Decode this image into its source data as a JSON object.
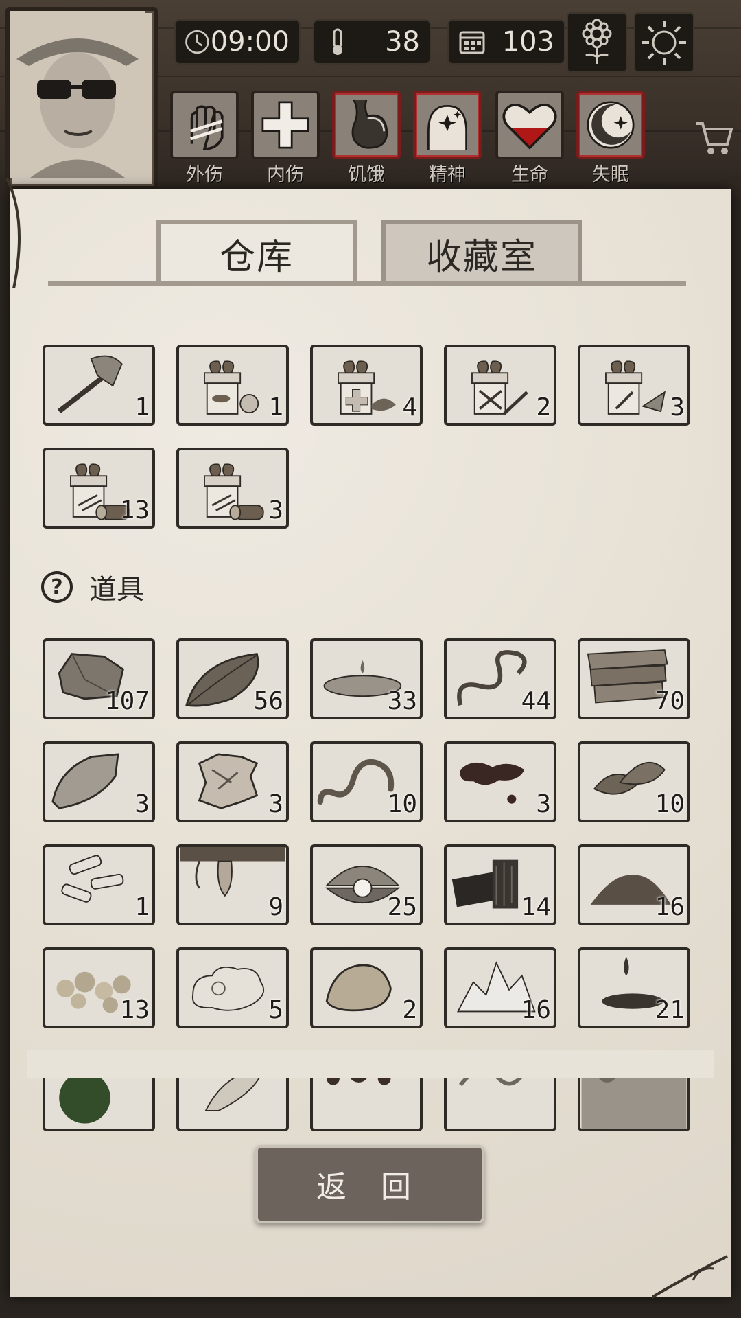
{
  "hud": {
    "time": "09:00",
    "temperature": "38",
    "day": "103",
    "icons": {
      "clock": "clock-icon",
      "thermometer": "thermometer-icon",
      "calendar": "calendar-icon",
      "flower": "flower-icon",
      "sun": "sun-icon",
      "cart": "cart-icon"
    }
  },
  "status_bar": [
    {
      "label": "外伤",
      "icon": "hand-bandage-icon",
      "warning": false
    },
    {
      "label": "内伤",
      "icon": "cross-icon",
      "warning": false
    },
    {
      "label": "饥饿",
      "icon": "stomach-icon",
      "warning": true
    },
    {
      "label": "精神",
      "icon": "head-sparkle-icon",
      "warning": true
    },
    {
      "label": "生命",
      "icon": "heart-icon",
      "warning": false,
      "fill": 0.45
    },
    {
      "label": "失眠",
      "icon": "moon-star-icon",
      "warning": true
    }
  ],
  "tabs": {
    "storage": "仓库",
    "collection": "收藏室",
    "active": "storage"
  },
  "equipment": [
    {
      "item": "axe",
      "count": "1"
    },
    {
      "item": "gift-box-food",
      "count": "1"
    },
    {
      "item": "gift-box-medical",
      "count": "4"
    },
    {
      "item": "gift-box-weapons",
      "count": "2"
    },
    {
      "item": "gift-box-tools",
      "count": "3"
    },
    {
      "item": "gift-box-wood",
      "count": "13"
    },
    {
      "item": "gift-box-wood",
      "count": "3"
    }
  ],
  "props_section": {
    "title": "道具",
    "icon": "question-icon"
  },
  "props": [
    {
      "item": "stone",
      "count": "107"
    },
    {
      "item": "leaf",
      "count": "56"
    },
    {
      "item": "water-puddle",
      "count": "33"
    },
    {
      "item": "vine",
      "count": "44"
    },
    {
      "item": "planks",
      "count": "70"
    },
    {
      "item": "flint",
      "count": "3"
    },
    {
      "item": "animal-hide",
      "count": "3"
    },
    {
      "item": "worm",
      "count": "10"
    },
    {
      "item": "blood",
      "count": "3"
    },
    {
      "item": "herb",
      "count": "10"
    },
    {
      "item": "bone-shards",
      "count": "1"
    },
    {
      "item": "tree-sap",
      "count": "9"
    },
    {
      "item": "pearl-shell",
      "count": "25"
    },
    {
      "item": "charcoal",
      "count": "14"
    },
    {
      "item": "dirt-pile",
      "count": "16"
    },
    {
      "item": "gold-nuggets",
      "count": "13"
    },
    {
      "item": "cotton",
      "count": "5"
    },
    {
      "item": "ore-rock",
      "count": "2"
    },
    {
      "item": "salt-crystal",
      "count": "16"
    },
    {
      "item": "oil-drop",
      "count": "21"
    },
    {
      "item": "green-item",
      "count": ""
    },
    {
      "item": "feather",
      "count": ""
    },
    {
      "item": "mud",
      "count": ""
    },
    {
      "item": "rope",
      "count": ""
    },
    {
      "item": "cloth",
      "count": ""
    }
  ],
  "back_button": "返 回",
  "colors": {
    "paper": "#e9e4da",
    "frame": "#2e2a26",
    "warning": "#b03030",
    "heart": "#b01818"
  }
}
